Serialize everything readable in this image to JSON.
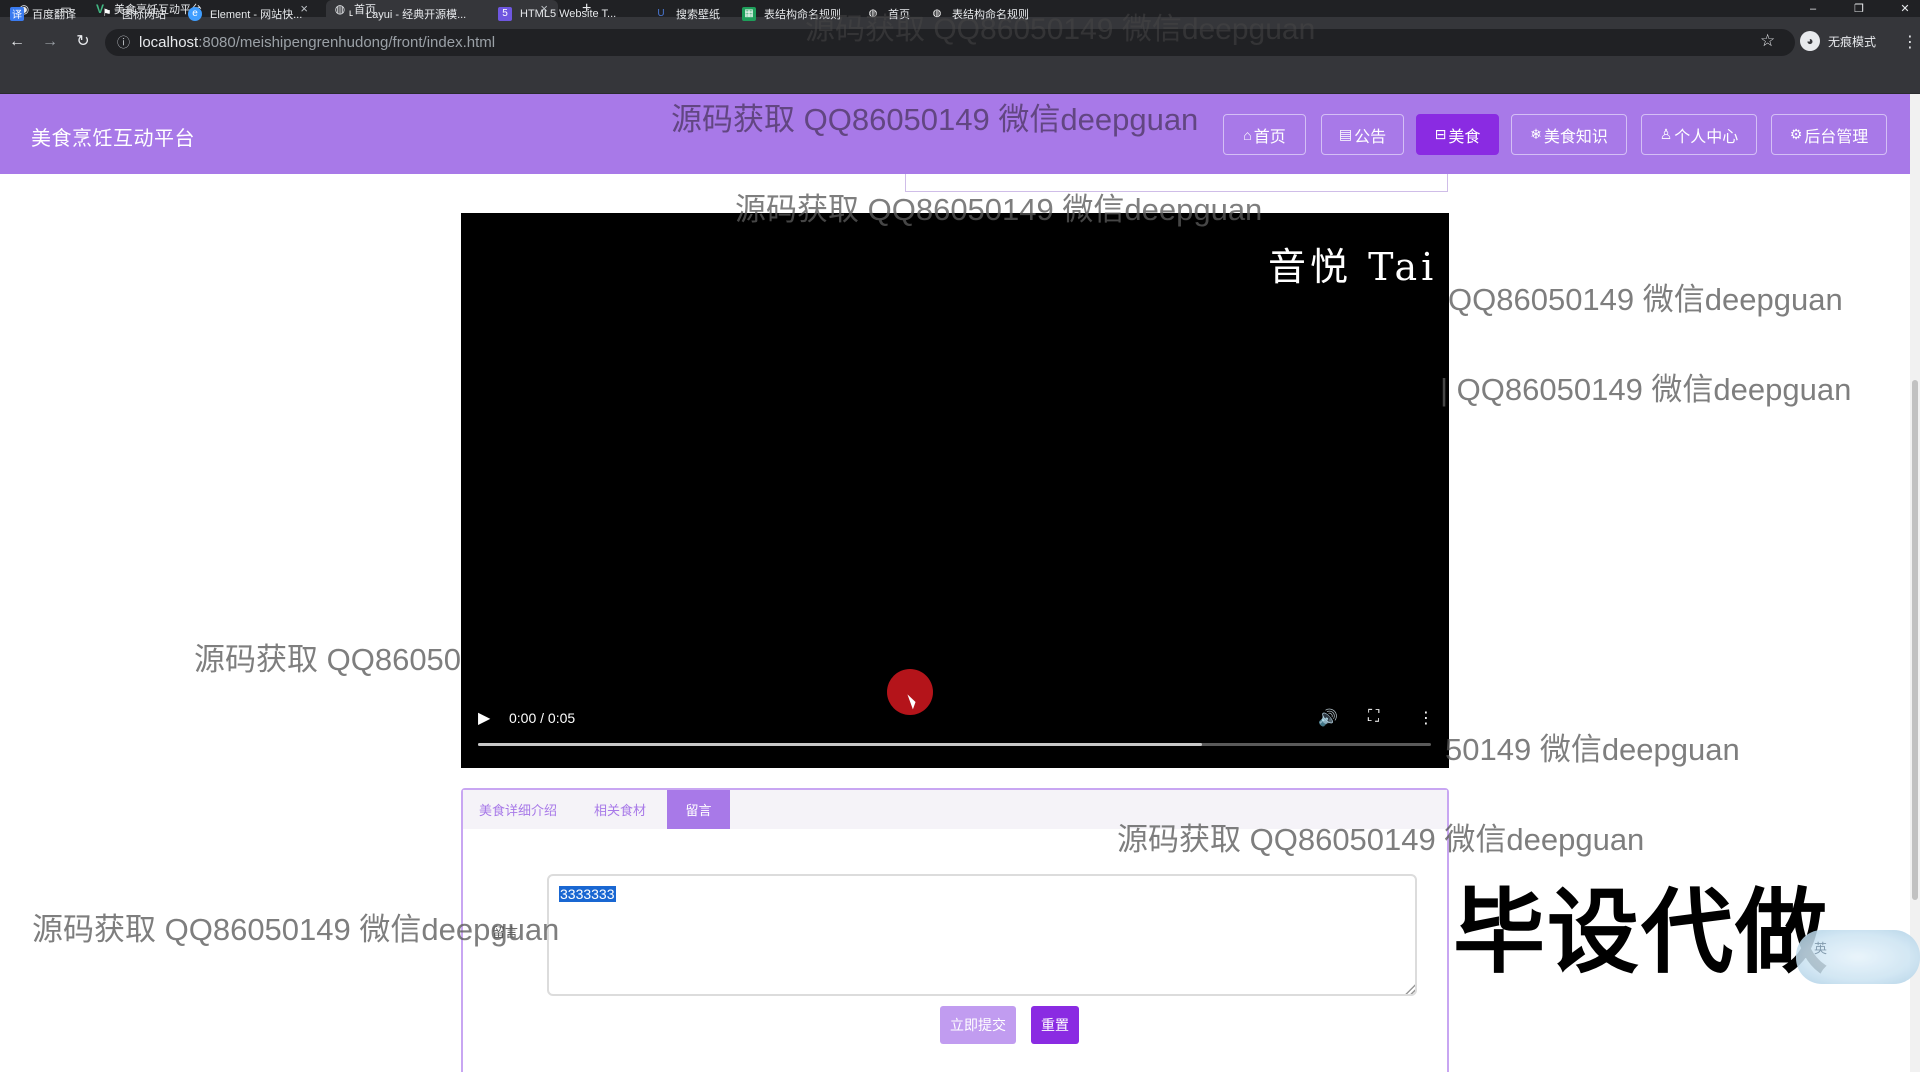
{
  "browser": {
    "tabs": [
      {
        "title": "美食烹饪互动平台",
        "icon": "vue-icon"
      },
      {
        "title": "首页",
        "icon": "globe-icon"
      }
    ],
    "url_host": "localhost",
    "url_path": ":8080/meishipengrenhudong/front/index.html",
    "profile_label": "无痕模式",
    "bookmarks": [
      {
        "label": "百度翻译",
        "icon": "translate-icon",
        "color": "#3a7bf0"
      },
      {
        "label": "图标网站",
        "icon": "flag-icon",
        "color": "#333333"
      },
      {
        "label": "Element - 网站快...",
        "icon": "element-icon",
        "color": "#409eff"
      },
      {
        "label": "Layui - 经典开源模...",
        "icon": "layui-icon",
        "color": "#5fb878"
      },
      {
        "label": "HTML5 Website T...",
        "icon": "html5-icon",
        "color": "#6f57e0"
      },
      {
        "label": "搜索壁纸",
        "icon": "wallpaper-icon",
        "color": "#4a78d6"
      },
      {
        "label": "表结构命名规则",
        "icon": "sheet-icon",
        "color": "#1e9e5a"
      },
      {
        "label": "首页",
        "icon": "globe-icon",
        "color": "#5f6368"
      },
      {
        "label": "表结构命名规则",
        "icon": "globe-icon",
        "color": "#5f6368"
      }
    ]
  },
  "site": {
    "title": "美食烹饪互动平台",
    "nav": [
      {
        "label": "首页",
        "icon": "⌂",
        "active": false
      },
      {
        "label": "公告",
        "icon": "▤",
        "active": false
      },
      {
        "label": "美食",
        "icon": "⊟",
        "active": true
      },
      {
        "label": "美食知识",
        "icon": "❄",
        "active": false
      },
      {
        "label": "个人中心",
        "icon": "♙",
        "active": false
      },
      {
        "label": "后台管理",
        "icon": "⚙",
        "active": false
      }
    ],
    "accent": "#a879e8",
    "active_color": "#8a2be2"
  },
  "video": {
    "time": "0:00 / 0:05",
    "watermark": "音悦 Tai",
    "buffered": 0.76
  },
  "detail_tabs": [
    "美食详细介绍",
    "相关食材",
    "留言"
  ],
  "active_tab": "留言",
  "comment_form": {
    "label": "留言",
    "value": "3333333",
    "submit": "立即提交",
    "reset": "重置"
  },
  "overlay": {
    "watermark_text": "源码获取 QQ86050149 微信deepguan",
    "watermark_partial_a": "QQ86050149 微信deepguan",
    "watermark_partial_b": "| QQ86050149 微信deepguan",
    "watermark_partial_c": "源码获取 QQ86050",
    "watermark_partial_d": "50149 微信deepguan",
    "big_text": "毕设代做",
    "sticker_text": "英"
  }
}
